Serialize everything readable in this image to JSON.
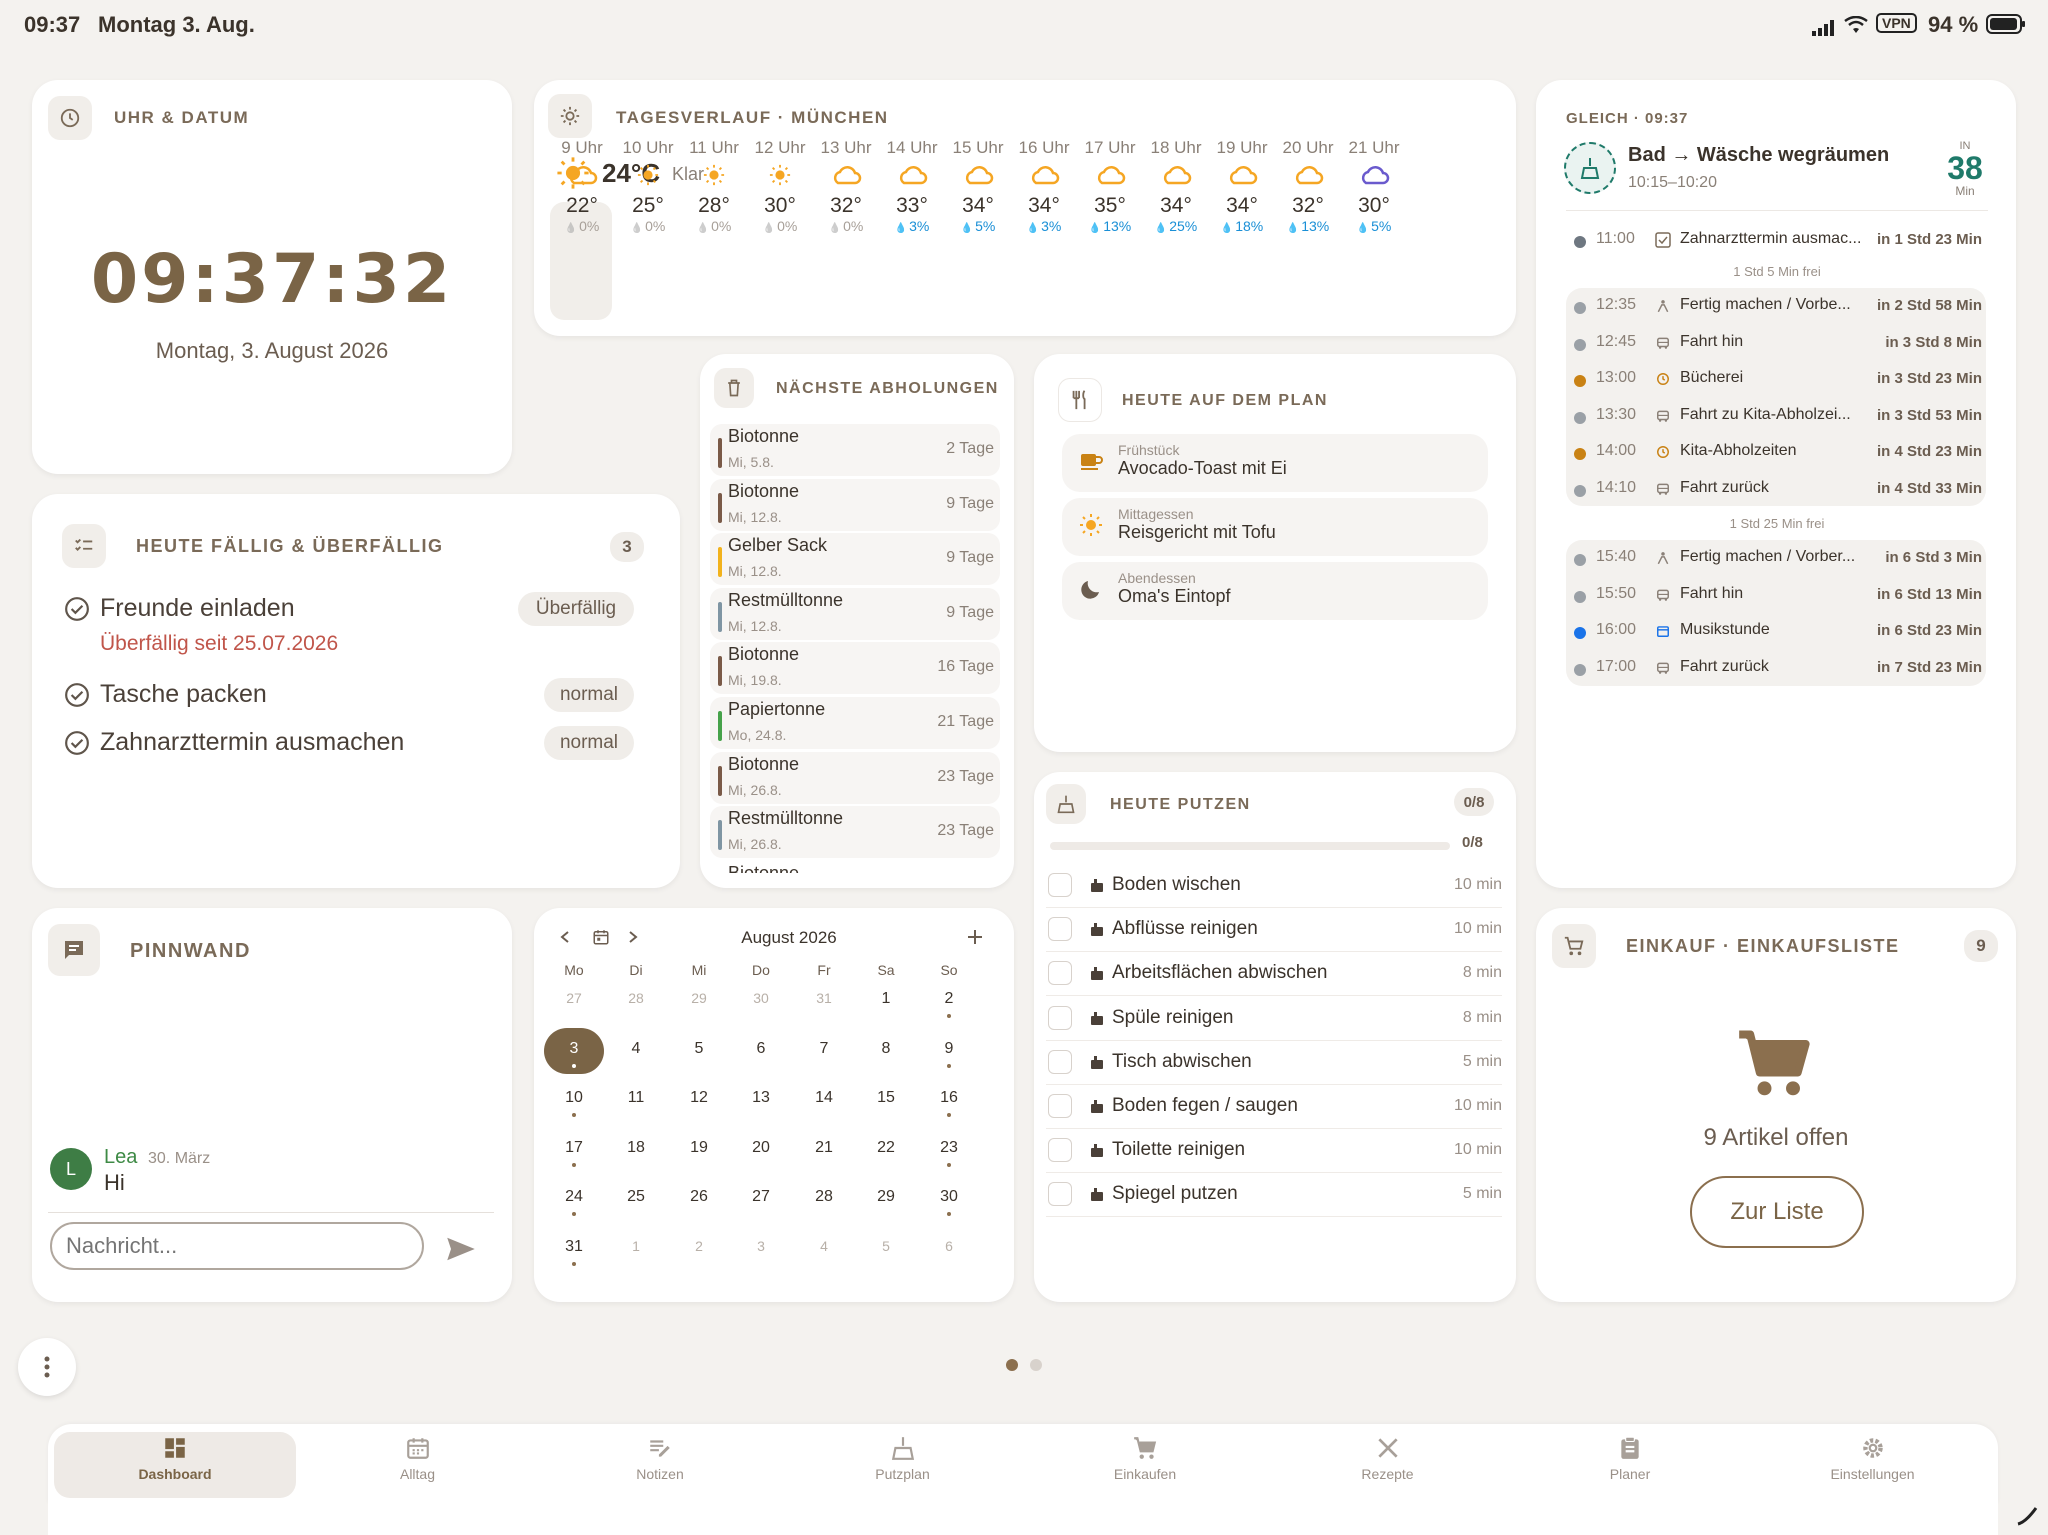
{
  "status": {
    "time": "09:37",
    "date": "Montag 3. Aug.",
    "vpn": "VPN",
    "battery": "94 %"
  },
  "clock": {
    "title": "UHR & DATUM",
    "time": "09:37:32",
    "date": "Montag, 3. August 2026"
  },
  "weather": {
    "title": "TAGESVERLAUF · MÜNCHEN",
    "current_temp": "24°C",
    "current_cond": "Klar",
    "hours": [
      {
        "h": "9 Uhr",
        "icon": "cloud",
        "t": "22°",
        "p": "0%"
      },
      {
        "h": "10 Uhr",
        "icon": "sun",
        "t": "25°",
        "p": "0%"
      },
      {
        "h": "11 Uhr",
        "icon": "sun",
        "t": "28°",
        "p": "0%"
      },
      {
        "h": "12 Uhr",
        "icon": "sun",
        "t": "30°",
        "p": "0%"
      },
      {
        "h": "13 Uhr",
        "icon": "cloud",
        "t": "32°",
        "p": "0%"
      },
      {
        "h": "14 Uhr",
        "icon": "cloud",
        "t": "33°",
        "p": "3%"
      },
      {
        "h": "15 Uhr",
        "icon": "cloud",
        "t": "34°",
        "p": "5%"
      },
      {
        "h": "16 Uhr",
        "icon": "cloud",
        "t": "34°",
        "p": "3%"
      },
      {
        "h": "17 Uhr",
        "icon": "cloud",
        "t": "35°",
        "p": "13%"
      },
      {
        "h": "18 Uhr",
        "icon": "cloud",
        "t": "34°",
        "p": "25%"
      },
      {
        "h": "19 Uhr",
        "icon": "cloud",
        "t": "34°",
        "p": "18%"
      },
      {
        "h": "20 Uhr",
        "icon": "cloud",
        "t": "32°",
        "p": "13%"
      },
      {
        "h": "21 Uhr",
        "icon": "cloud-night",
        "t": "30°",
        "p": "5%"
      }
    ]
  },
  "next": {
    "label": "GLEICH · 09:37",
    "title": "Bad → Wäsche wegräumen",
    "time": "10:15–10:20",
    "in_label": "IN",
    "in_value": "38",
    "in_unit": "Min",
    "first": {
      "tm": "11:00",
      "tt": "Zahnarzttermin ausmac...",
      "tr": "in 1 Std 23 Min"
    },
    "gap1": "1 Std 5 Min frei",
    "group1": [
      {
        "tm": "12:35",
        "icon": "person",
        "tt": "Fertig machen / Vorbe...",
        "tr": "in 2 Std 58 Min",
        "c": "#9aa0a6"
      },
      {
        "tm": "12:45",
        "icon": "car",
        "tt": "Fahrt hin",
        "tr": "in 3 Std 8 Min",
        "c": "#9aa0a6"
      },
      {
        "tm": "13:00",
        "icon": "clock",
        "tt": "Bücherei",
        "tr": "in 3 Std 23 Min",
        "c": "#c98214"
      },
      {
        "tm": "13:30",
        "icon": "car",
        "tt": "Fahrt zu Kita-Abholzei...",
        "tr": "in 3 Std 53 Min",
        "c": "#9aa0a6"
      },
      {
        "tm": "14:00",
        "icon": "clock",
        "tt": "Kita-Abholzeiten",
        "tr": "in 4 Std 23 Min",
        "c": "#c98214"
      },
      {
        "tm": "14:10",
        "icon": "car",
        "tt": "Fahrt zurück",
        "tr": "in 4 Std 33 Min",
        "c": "#9aa0a6"
      }
    ],
    "gap2": "1 Std 25 Min frei",
    "group2": [
      {
        "tm": "15:40",
        "icon": "person",
        "tt": "Fertig machen / Vorber...",
        "tr": "in 6 Std 3 Min",
        "c": "#9aa0a6"
      },
      {
        "tm": "15:50",
        "icon": "car",
        "tt": "Fahrt hin",
        "tr": "in 6 Std 13 Min",
        "c": "#9aa0a6"
      },
      {
        "tm": "16:00",
        "icon": "calendar",
        "tt": "Musikstunde",
        "tr": "in 6 Std 23 Min",
        "c": "#1a73e8"
      },
      {
        "tm": "17:00",
        "icon": "car",
        "tt": "Fahrt zurück",
        "tr": "in 7 Std 23 Min",
        "c": "#9aa0a6"
      }
    ]
  },
  "due": {
    "title": "HEUTE FÄLLIG & ÜBERFÄLLIG",
    "count": "3",
    "items": [
      {
        "name": "Freunde einladen",
        "badge": "Überfällig",
        "sub": "Überfällig seit 25.07.2026"
      },
      {
        "name": "Tasche packen",
        "badge": "normal",
        "sub": ""
      },
      {
        "name": "Zahnarzttermin ausmachen",
        "badge": "normal",
        "sub": ""
      }
    ]
  },
  "trash": {
    "title": "NÄCHSTE ABHOLUNGEN",
    "items": [
      {
        "n": "Biotonne",
        "d": "Mi, 5.8.",
        "r": "2 Tage",
        "c": "#7a5a48"
      },
      {
        "n": "Biotonne",
        "d": "Mi, 12.8.",
        "r": "9 Tage",
        "c": "#7a5a48"
      },
      {
        "n": "Gelber Sack",
        "d": "Mi, 12.8.",
        "r": "9 Tage",
        "c": "#f2b21c"
      },
      {
        "n": "Restmülltonne",
        "d": "Mi, 12.8.",
        "r": "9 Tage",
        "c": "#7f95a3"
      },
      {
        "n": "Biotonne",
        "d": "Mi, 19.8.",
        "r": "16 Tage",
        "c": "#7a5a48"
      },
      {
        "n": "Papiertonne",
        "d": "Mo, 24.8.",
        "r": "21 Tage",
        "c": "#46a24a"
      },
      {
        "n": "Biotonne",
        "d": "Mi, 26.8.",
        "r": "23 Tage",
        "c": "#7a5a48"
      },
      {
        "n": "Restmülltonne",
        "d": "Mi, 26.8.",
        "r": "23 Tage",
        "c": "#7f95a3"
      },
      {
        "n": "Biotonne",
        "d": "",
        "r": "",
        "c": "#7a5a48"
      }
    ]
  },
  "meals": {
    "title": "HEUTE AUF DEM PLAN",
    "items": [
      {
        "label": "Frühstück",
        "value": "Avocado-Toast mit Ei",
        "icon": "cup-icon"
      },
      {
        "label": "Mittagessen",
        "value": "Reisgericht mit Tofu",
        "icon": "sun-icon"
      },
      {
        "label": "Abendessen",
        "value": "Oma's Eintopf",
        "icon": "moon-icon"
      }
    ]
  },
  "clean": {
    "title": "HEUTE PUTZEN",
    "badge": "0/8",
    "progress_label": "0/8",
    "progress": 0,
    "items": [
      {
        "n": "Boden wischen",
        "m": "10 min"
      },
      {
        "n": "Abflüsse reinigen",
        "m": "10 min"
      },
      {
        "n": "Arbeitsflächen abwischen",
        "m": "8 min"
      },
      {
        "n": "Spüle reinigen",
        "m": "8 min"
      },
      {
        "n": "Tisch abwischen",
        "m": "5 min"
      },
      {
        "n": "Boden fegen / saugen",
        "m": "10 min"
      },
      {
        "n": "Toilette reinigen",
        "m": "10 min"
      },
      {
        "n": "Spiegel putzen",
        "m": "5 min"
      }
    ]
  },
  "board": {
    "title": "PINNWAND",
    "author": "Lea",
    "avatar": "L",
    "date": "30. März",
    "message": "Hi",
    "placeholder": "Nachricht..."
  },
  "calendar": {
    "month": "August 2026",
    "weekdays": [
      "Mo",
      "Di",
      "Mi",
      "Do",
      "Fr",
      "Sa",
      "So"
    ],
    "weeks": [
      [
        {
          "d": "27",
          "o": 1
        },
        {
          "d": "28",
          "o": 1
        },
        {
          "d": "29",
          "o": 1
        },
        {
          "d": "30",
          "o": 1
        },
        {
          "d": "31",
          "o": 1
        },
        {
          "d": "1"
        },
        {
          "d": "2",
          "e": 1
        }
      ],
      [
        {
          "d": "3",
          "s": 1,
          "e": 1
        },
        {
          "d": "4"
        },
        {
          "d": "5"
        },
        {
          "d": "6"
        },
        {
          "d": "7"
        },
        {
          "d": "8"
        },
        {
          "d": "9",
          "e": 1
        }
      ],
      [
        {
          "d": "10",
          "e": 1
        },
        {
          "d": "11"
        },
        {
          "d": "12"
        },
        {
          "d": "13"
        },
        {
          "d": "14"
        },
        {
          "d": "15"
        },
        {
          "d": "16",
          "e": 1
        }
      ],
      [
        {
          "d": "17",
          "e": 1
        },
        {
          "d": "18"
        },
        {
          "d": "19"
        },
        {
          "d": "20"
        },
        {
          "d": "21"
        },
        {
          "d": "22"
        },
        {
          "d": "23",
          "e": 1
        }
      ],
      [
        {
          "d": "24",
          "e": 1
        },
        {
          "d": "25"
        },
        {
          "d": "26"
        },
        {
          "d": "27"
        },
        {
          "d": "28"
        },
        {
          "d": "29"
        },
        {
          "d": "30",
          "e": 1
        }
      ],
      [
        {
          "d": "31",
          "e": 1
        },
        {
          "d": "1",
          "o": 1
        },
        {
          "d": "2",
          "o": 1
        },
        {
          "d": "3",
          "o": 1
        },
        {
          "d": "4",
          "o": 1
        },
        {
          "d": "5",
          "o": 1
        },
        {
          "d": "6",
          "o": 1
        }
      ]
    ]
  },
  "shopping": {
    "title": "EINKAUF · EINKAUFSLISTE",
    "count": "9",
    "open": "9 Artikel offen",
    "button": "Zur Liste"
  },
  "nav": [
    {
      "label": "Dashboard",
      "icon": "dashboard-icon",
      "active": true
    },
    {
      "label": "Alltag",
      "icon": "calendar-icon"
    },
    {
      "label": "Notizen",
      "icon": "notes-icon"
    },
    {
      "label": "Putzplan",
      "icon": "broom-icon"
    },
    {
      "label": "Einkaufen",
      "icon": "cart-icon"
    },
    {
      "label": "Rezepte",
      "icon": "utensils-icon"
    },
    {
      "label": "Planer",
      "icon": "clipboard-icon"
    },
    {
      "label": "Einstellungen",
      "icon": "gear-icon"
    }
  ],
  "colors": {
    "accent": "#8b6f4e",
    "teal": "#1f7a6a",
    "overdue": "#c0554a",
    "rain": "#1a8fd6"
  }
}
